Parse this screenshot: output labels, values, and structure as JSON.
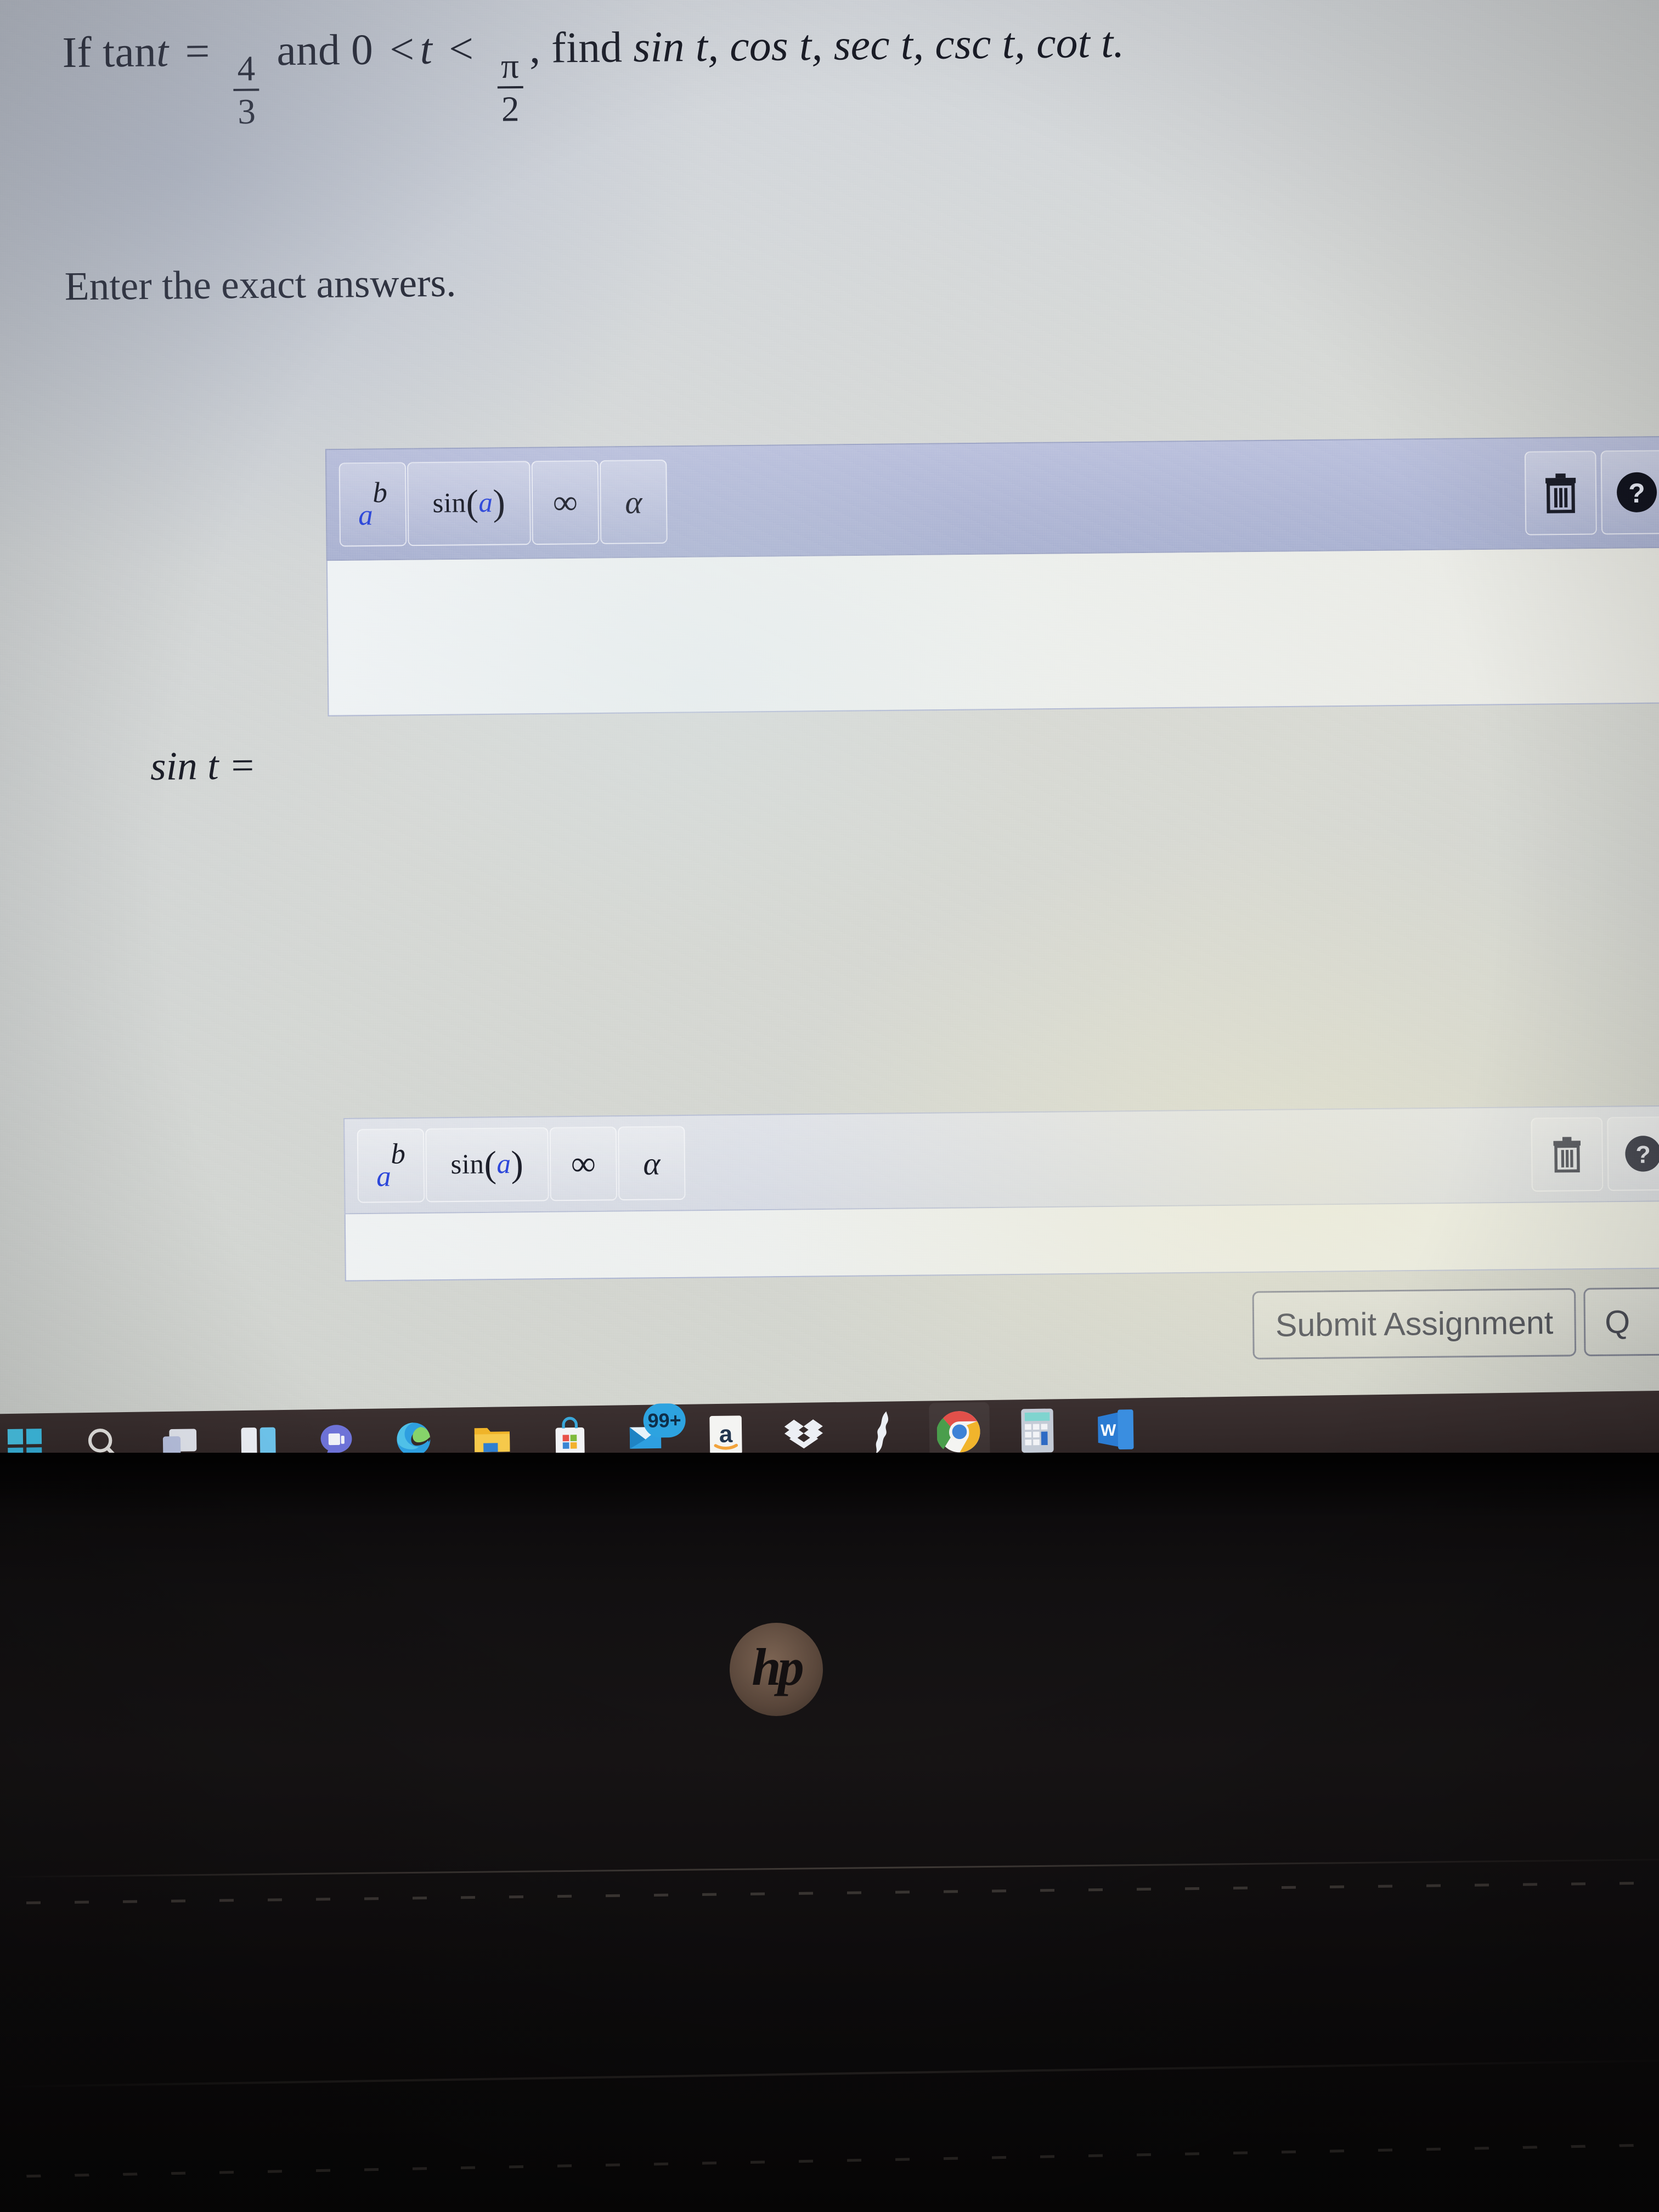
{
  "question": {
    "prefix": "If tan",
    "var": "t",
    "equals": "=",
    "fraction": {
      "numerator": "4",
      "denominator": "3"
    },
    "and": "and",
    "zero": "0",
    "lt1": "<",
    "var2": "t",
    "lt2": "<",
    "fraction2": {
      "numerator": "π",
      "denominator": "2"
    },
    "comma": ",",
    "find": "find",
    "functions": "sin t, cos t, sec t, csc t, cot t.",
    "full_text": "If tan t = 4/3 and 0 < t < π/2, find sin t, cos t, sec t, csc t, cot t."
  },
  "subprompt": "Enter the exact answers.",
  "answer_rows": [
    {
      "label": "sin t =",
      "value": "",
      "toolbar": {
        "buttons": [
          {
            "name": "exponent",
            "base": "a",
            "exp": "b"
          },
          {
            "name": "sin-function",
            "fn": "sin",
            "open": "(",
            "arg": "a",
            "close": ")"
          },
          {
            "name": "infinity",
            "glyph": "∞"
          },
          {
            "name": "greek-alpha",
            "glyph": "α"
          }
        ],
        "right_buttons": [
          {
            "name": "trash",
            "title": "Clear"
          },
          {
            "name": "help",
            "title": "Help",
            "glyph": "?"
          }
        ]
      }
    },
    {
      "label": "",
      "value": "",
      "toolbar": {
        "buttons": [
          {
            "name": "exponent",
            "base": "a",
            "exp": "b"
          },
          {
            "name": "sin-function",
            "fn": "sin",
            "open": "(",
            "arg": "a",
            "close": ")"
          },
          {
            "name": "infinity",
            "glyph": "∞"
          },
          {
            "name": "greek-alpha",
            "glyph": "α"
          }
        ],
        "right_buttons": [
          {
            "name": "trash",
            "title": "Clear"
          },
          {
            "name": "help",
            "title": "Help",
            "glyph": "?"
          }
        ]
      }
    }
  ],
  "actions": {
    "submit_label": "Submit Assignment",
    "quit_label": "Q"
  },
  "taskbar": {
    "items": [
      {
        "name": "start",
        "icon": "windows-logo-icon",
        "state": "idle"
      },
      {
        "name": "search",
        "icon": "search-icon",
        "state": "idle"
      },
      {
        "name": "task-view",
        "icon": "task-view-icon",
        "state": "idle"
      },
      {
        "name": "widgets",
        "icon": "widgets-icon",
        "state": "idle"
      },
      {
        "name": "chat",
        "icon": "teams-chat-icon",
        "state": "idle"
      },
      {
        "name": "edge",
        "icon": "edge-browser-icon",
        "state": "idle"
      },
      {
        "name": "file-explorer",
        "icon": "folder-icon",
        "state": "idle"
      },
      {
        "name": "microsoft-store",
        "icon": "store-bag-icon",
        "state": "idle"
      },
      {
        "name": "mail",
        "icon": "mail-icon",
        "badge": "99+",
        "state": "idle"
      },
      {
        "name": "amazon",
        "icon": "amazon-a-icon",
        "state": "idle"
      },
      {
        "name": "dropbox",
        "icon": "dropbox-icon",
        "state": "idle"
      },
      {
        "name": "sonic",
        "icon": "lightning-s-icon",
        "state": "idle"
      },
      {
        "name": "chrome",
        "icon": "chrome-icon",
        "state": "active"
      },
      {
        "name": "calculator",
        "icon": "calculator-icon",
        "state": "running"
      },
      {
        "name": "word",
        "icon": "word-icon",
        "state": "running"
      }
    ]
  },
  "hardware": {
    "brand": "hp"
  },
  "colors": {
    "toolbar_bg": "#aeb5d4",
    "toolbar_border": "#9aa2c4",
    "field_bg": "#eef2f4",
    "math_blue": "#2b44d8",
    "text": "#181a24",
    "taskbar_bg": "#342a2a",
    "accent_active": "#63c7ef",
    "bezel": "#121011"
  }
}
